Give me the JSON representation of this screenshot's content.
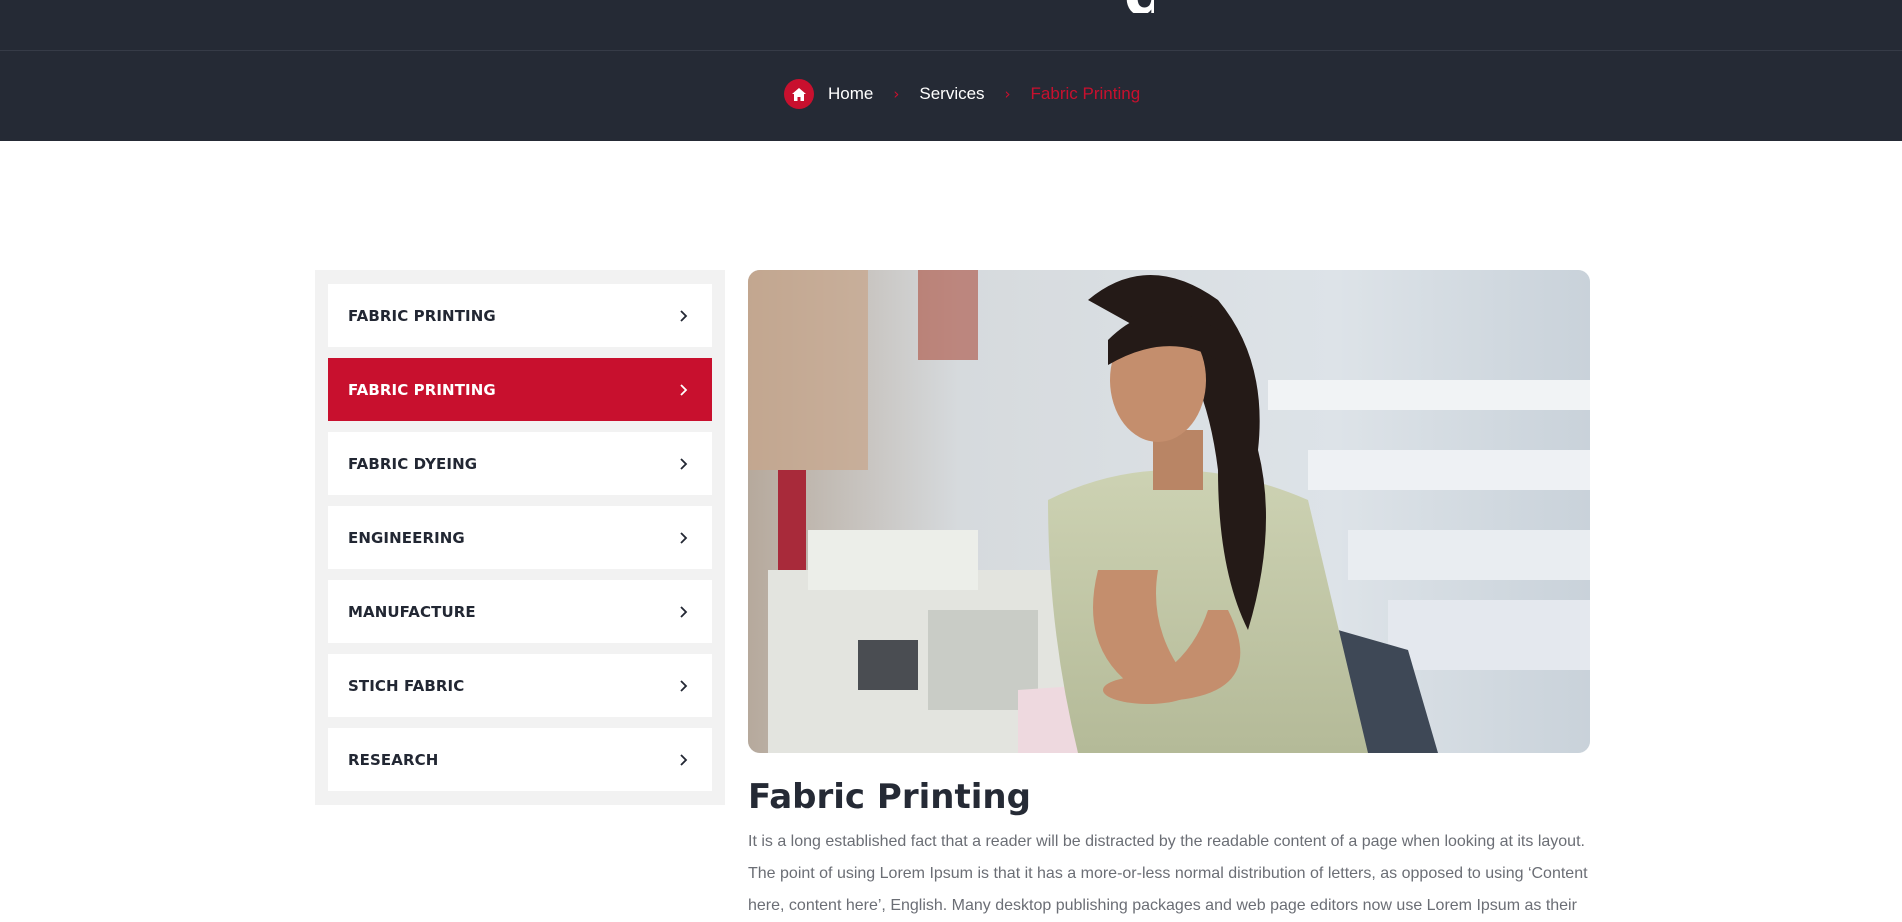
{
  "hero": {
    "title_fragment": "g"
  },
  "breadcrumb": {
    "home_icon": "home-icon",
    "items": [
      {
        "label": "Home"
      },
      {
        "label": "Services"
      }
    ],
    "current": "Fabric Printing",
    "separator": "›"
  },
  "sidebar": {
    "chevron_icon": "chevron-right-icon",
    "active_index": 1,
    "items": [
      {
        "label": "FABRIC PRINTING"
      },
      {
        "label": "FABRIC PRINTING"
      },
      {
        "label": "FABRIC DYEING"
      },
      {
        "label": "ENGINEERING"
      },
      {
        "label": "MANUFACTURE"
      },
      {
        "label": "STICH FABRIC"
      },
      {
        "label": "RESEARCH"
      }
    ]
  },
  "main": {
    "image": "woman-operating-sewing-machine-photo",
    "title": "Fabric Printing",
    "body": "It is a long established fact that a reader will be distracted by the readable content of a page when looking at its layout. The point of using Lorem Ipsum is that it has a more-or-less normal distribution of letters, as opposed to using ‘Content here, content here’, English. Many desktop publishing packages and web page editors now use Lorem Ipsum as their"
  },
  "colors": {
    "accent": "#c8102e",
    "dark": "#252a35",
    "sidebar_bg": "#f2f2f2",
    "body_text": "#6b6e75"
  }
}
